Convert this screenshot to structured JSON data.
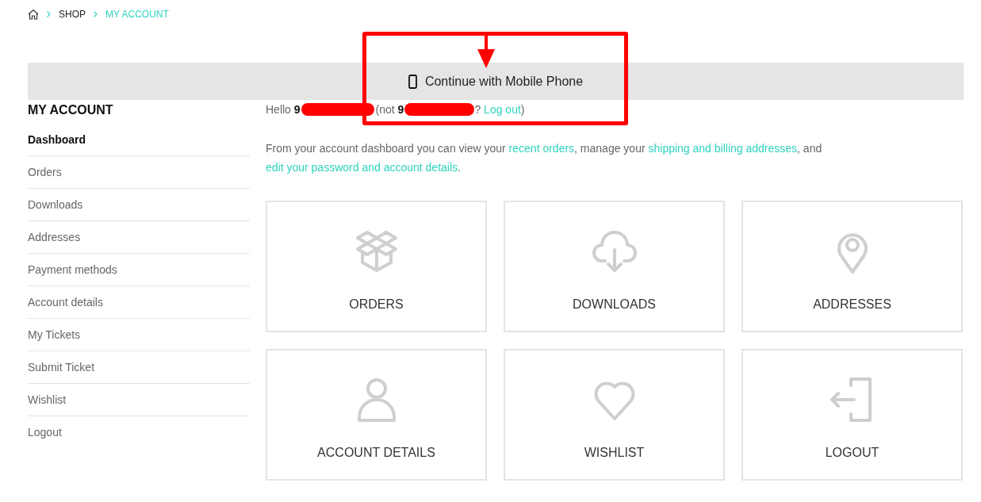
{
  "breadcrumb": [
    {
      "label": "SHOP",
      "current": false
    },
    {
      "label": "MY ACCOUNT",
      "current": true
    }
  ],
  "banner": {
    "label": "Continue with Mobile Phone"
  },
  "sidebar": {
    "title": "MY ACCOUNT",
    "items": [
      {
        "label": "Dashboard",
        "selected": true
      },
      {
        "label": "Orders",
        "selected": false
      },
      {
        "label": "Downloads",
        "selected": false
      },
      {
        "label": "Addresses",
        "selected": false
      },
      {
        "label": "Payment methods",
        "selected": false
      },
      {
        "label": "Account details",
        "selected": false
      },
      {
        "label": "My Tickets",
        "selected": false
      },
      {
        "label": "Submit Ticket",
        "selected": false
      },
      {
        "label": "Wishlist",
        "selected": false
      },
      {
        "label": "Logout",
        "selected": false
      }
    ]
  },
  "greeting": {
    "hello": "Hello **9**",
    "not": "(not **9**",
    "question": "?",
    "link": "Log out",
    "close": ")"
  },
  "intro": {
    "segments": [
      {
        "text": "From your account dashboard you can view your ",
        "link": "recent orders"
      },
      {
        "text": ", manage your ",
        "link": "shipping and billing addresses"
      },
      {
        "text": ", and ",
        "link": "edit your password and account details"
      }
    ],
    "end": "."
  },
  "cards": [
    {
      "kind": "box",
      "label": "ORDERS"
    },
    {
      "kind": "cloud",
      "label": "DOWNLOADS"
    },
    {
      "kind": "pin",
      "label": "ADDRESSES"
    },
    {
      "kind": "person",
      "label": "ACCOUNT DETAILS"
    },
    {
      "kind": "heart",
      "label": "WISHLIST"
    },
    {
      "kind": "exit",
      "label": "LOGOUT"
    }
  ]
}
